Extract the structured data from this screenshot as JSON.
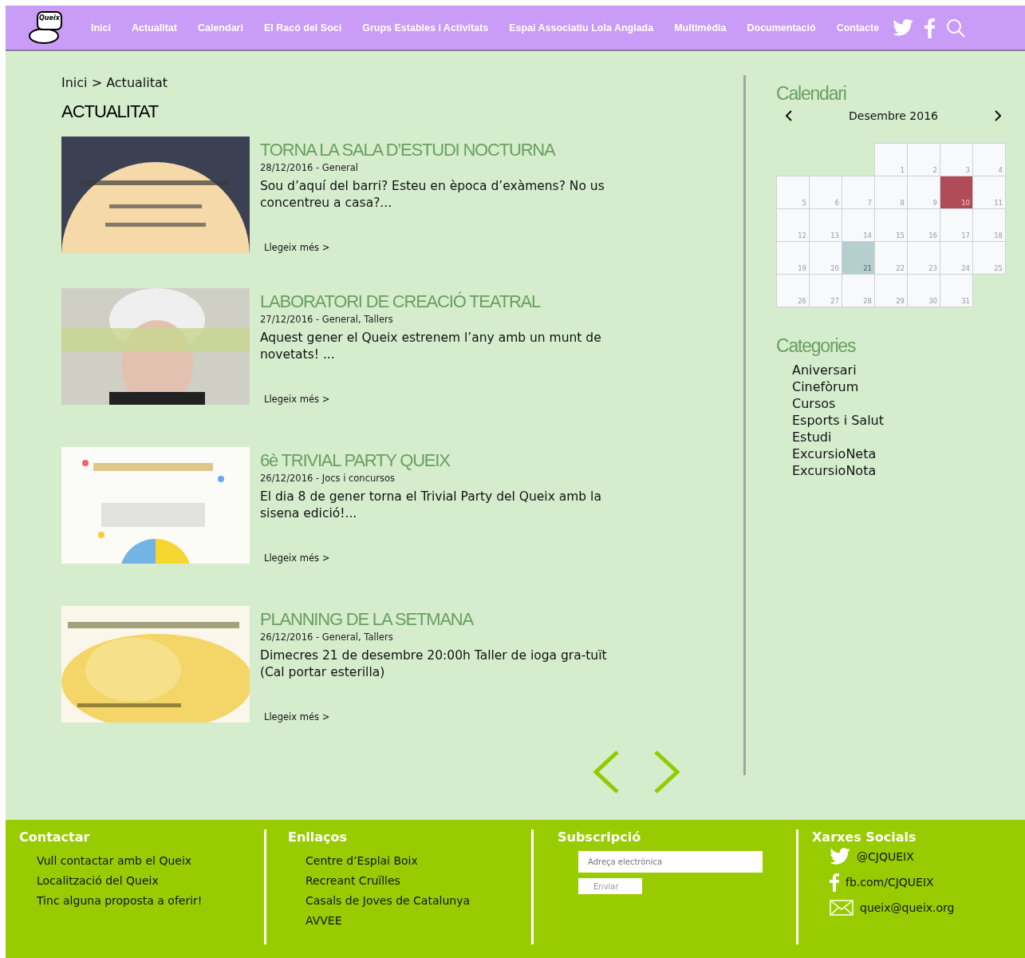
{
  "header": {
    "logo": "Queix",
    "nav": [
      {
        "label": "Inici",
        "selected": false
      },
      {
        "label": "Actualitat",
        "selected": false
      },
      {
        "label": "Calendari",
        "selected": false
      },
      {
        "label": "El Racó del Soci",
        "selected": false
      },
      {
        "label": "Grups Estables i Activitats",
        "selected": false
      },
      {
        "label": "Espai Associatiu Lola Anglada",
        "selected": false
      },
      {
        "label": "Multimèdia",
        "selected": false
      },
      {
        "label": "Documentació",
        "selected": false
      },
      {
        "label": "Contacte",
        "selected": false
      }
    ]
  },
  "breadcrumb": [
    "Inici",
    "Actualitat"
  ],
  "breadcrumb_separator": ">",
  "page_title": "ACTUALITAT",
  "articles": [
    {
      "title": "TORNA LA SALA D’ESTUDI NOCTURNA",
      "meta": "28/12/2016 - General",
      "excerpt": "Sou d’aquí del barri? Esteu en època d’exàmens? No us concentreu a casa?...",
      "more": "Llegeix més >"
    },
    {
      "title": "LABORATORI DE CREACIÓ TEATRAL",
      "meta": "27/12/2016 - General, Tallers",
      "excerpt": "Aquest gener el Queix estrenem l’any amb un munt de novetats! ...",
      "more": "Llegeix més >"
    },
    {
      "title": "6è TRIVIAL PARTY QUEIX",
      "meta": "26/12/2016 - Jocs i concursos",
      "excerpt": "El dia 8 de gener torna el Trivial Party del Queix amb la sisena edició!...",
      "more": "Llegeix més >"
    },
    {
      "title": "PLANNING DE LA SETMANA",
      "meta": "26/12/2016 - General, Tallers",
      "excerpt": "Dimecres 21 de desembre 20:00h Taller de ioga gra-tuït (Cal portar esterilla)",
      "more": "Llegeix més >"
    }
  ],
  "sidebar": {
    "calendar": {
      "title": "Calendari",
      "month": "Desembre 2016",
      "days": [
        {
          "day": "1",
          "selected": false,
          "today": false
        },
        {
          "day": "2",
          "selected": false,
          "today": false
        },
        {
          "day": "3",
          "selected": false,
          "today": false
        },
        {
          "day": "4",
          "selected": false,
          "today": false
        },
        {
          "day": "5",
          "selected": false,
          "today": false
        },
        {
          "day": "6",
          "selected": false,
          "today": false
        },
        {
          "day": "7",
          "selected": false,
          "today": false
        },
        {
          "day": "8",
          "selected": false,
          "today": false
        },
        {
          "day": "9",
          "selected": false,
          "today": false
        },
        {
          "day": "10",
          "selected": true,
          "today": false
        },
        {
          "day": "11",
          "selected": false,
          "today": false
        },
        {
          "day": "12",
          "selected": false,
          "today": false
        },
        {
          "day": "13",
          "selected": false,
          "today": false
        },
        {
          "day": "14",
          "selected": false,
          "today": false
        },
        {
          "day": "15",
          "selected": false,
          "today": false
        },
        {
          "day": "16",
          "selected": false,
          "today": false
        },
        {
          "day": "17",
          "selected": false,
          "today": false
        },
        {
          "day": "18",
          "selected": false,
          "today": false
        },
        {
          "day": "19",
          "selected": false,
          "today": false
        },
        {
          "day": "20",
          "selected": false,
          "today": false
        },
        {
          "day": "21",
          "selected": false,
          "today": true
        },
        {
          "day": "22",
          "selected": false,
          "today": false
        },
        {
          "day": "23",
          "selected": false,
          "today": false
        },
        {
          "day": "24",
          "selected": false,
          "today": false
        },
        {
          "day": "25",
          "selected": false,
          "today": false
        },
        {
          "day": "26",
          "selected": false,
          "today": false
        },
        {
          "day": "27",
          "selected": false,
          "today": false
        },
        {
          "day": "28",
          "selected": false,
          "today": false
        },
        {
          "day": "29",
          "selected": false,
          "today": false
        },
        {
          "day": "30",
          "selected": false,
          "today": false
        },
        {
          "day": "31",
          "selected": false,
          "today": false
        }
      ]
    },
    "categories": {
      "title": "Categories",
      "items": [
        "Aniversari",
        "Cinefòrum",
        "Cursos",
        "Esports i Salut",
        "Estudi",
        "ExcursioNeta",
        "ExcursioNota"
      ]
    }
  },
  "footer": {
    "contact": {
      "title": "Contactar",
      "links": [
        "Vull contactar amb el Queix",
        "Localització del Queix",
        "Tinc alguna proposta a oferir!"
      ]
    },
    "links": {
      "title": "Enllaços",
      "links": [
        "Centre d’Esplai Boix",
        "Recreant Cruïlles",
        "Casals de Joves de Catalunya",
        "AVVEE"
      ]
    },
    "subscribe": {
      "title": "Subscripció",
      "placeholder": "Adreça electrònica",
      "button": "Enviar"
    },
    "social": {
      "title": "Xarxes Socials",
      "items": [
        {
          "kind": "twitter",
          "label": "@CJQUEIX"
        },
        {
          "kind": "facebook",
          "label": "fb.com/CJQUEIX"
        },
        {
          "kind": "mail",
          "label": "queix@queix.org"
        }
      ]
    }
  }
}
